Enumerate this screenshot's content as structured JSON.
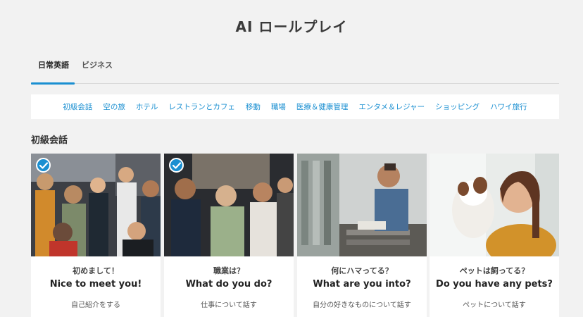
{
  "page": {
    "title": "AI ロールプレイ"
  },
  "tabs": [
    {
      "label": "日常英語",
      "active": true
    },
    {
      "label": "ビジネス",
      "active": false
    }
  ],
  "categories": [
    "初級会話",
    "空の旅",
    "ホテル",
    "レストランとカフェ",
    "移動",
    "職場",
    "医療＆健康管理",
    "エンタメ＆レジャー",
    "ショッピング",
    "ハワイ旅行"
  ],
  "section": {
    "heading": "初級会話"
  },
  "cards": [
    {
      "title_jp": "初めまして！",
      "title_en": "Nice to meet you!",
      "description": "自己紹介をする",
      "completed": true,
      "image": "party-crowd-photo"
    },
    {
      "title_jp": "職業は？",
      "title_en": "What do you do?",
      "description": "仕事について話す",
      "completed": true,
      "image": "networking-event-photo"
    },
    {
      "title_jp": "何にハマってる？",
      "title_en": "What are you into?",
      "description": "自分の好きなものについて話す",
      "completed": false,
      "image": "record-store-photo"
    },
    {
      "title_jp": "ペットは飼ってる？",
      "title_en": "Do you have any pets?",
      "description": "ペットについて話す",
      "completed": false,
      "image": "woman-with-dog-photo"
    }
  ],
  "colors": {
    "accent": "#1a8fd1",
    "background": "#f2f2f2",
    "card": "#ffffff"
  },
  "icons": {
    "completed": "check-circle-icon"
  }
}
